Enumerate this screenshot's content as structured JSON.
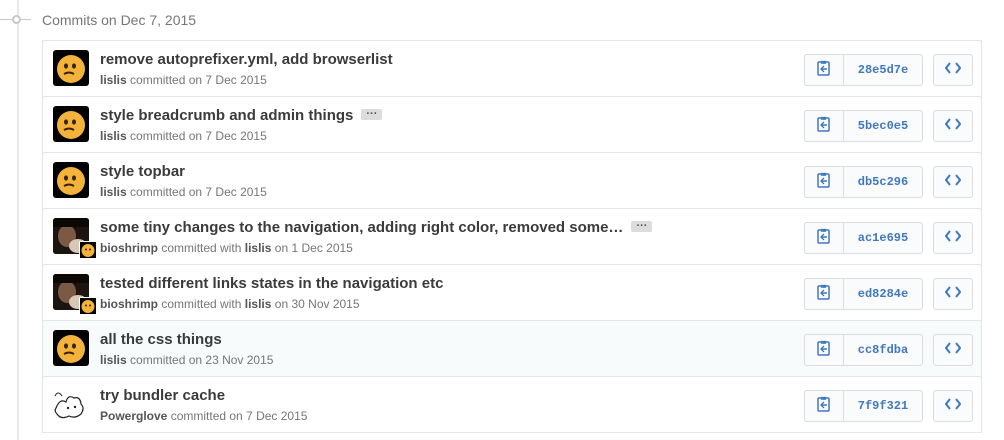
{
  "group": {
    "title": "Commits on Dec 7, 2015"
  },
  "commits": [
    {
      "title": "remove autoprefixer.yml, add browserlist",
      "author": "lislis",
      "verb": "committed on",
      "coauthor": "",
      "date": "7 Dec 2015",
      "sha": "28e5d7e",
      "avatar": "emoji",
      "ellipsis": ""
    },
    {
      "title": "style breadcrumb and admin things",
      "author": "lislis",
      "verb": "committed on",
      "coauthor": "",
      "date": "7 Dec 2015",
      "sha": "5bec0e5",
      "avatar": "emoji",
      "ellipsis": "···"
    },
    {
      "title": "style topbar",
      "author": "lislis",
      "verb": "committed on",
      "coauthor": "",
      "date": "7 Dec 2015",
      "sha": "db5c296",
      "avatar": "emoji",
      "ellipsis": ""
    },
    {
      "title": "some tiny changes to the navigation, adding right color, removed some…",
      "author": "bioshrimp",
      "verb": "committed with",
      "coauthor": "lislis",
      "on": "on",
      "date": "1 Dec 2015",
      "sha": "ac1e695",
      "avatar": "photo",
      "ellipsis": "···"
    },
    {
      "title": "tested different links states in the navigation etc",
      "author": "bioshrimp",
      "verb": "committed with",
      "coauthor": "lislis",
      "on": "on",
      "date": "30 Nov 2015",
      "sha": "ed8284e",
      "avatar": "photo",
      "ellipsis": ""
    },
    {
      "title": "all the css things",
      "author": "lislis",
      "verb": "committed on",
      "coauthor": "",
      "date": "23 Nov 2015",
      "sha": "cc8fdba",
      "avatar": "emoji",
      "ellipsis": ""
    },
    {
      "title": "try bundler cache",
      "author": "Powerglove",
      "verb": "committed on",
      "coauthor": "",
      "date": "7 Dec 2015",
      "sha": "7f9f321",
      "avatar": "sketch",
      "ellipsis": ""
    }
  ],
  "icons": {
    "copy": "clipboard-icon",
    "browse": "code-icon"
  },
  "colors": {
    "sha": "#4078c0",
    "accent_row": "#f7fbfc"
  }
}
